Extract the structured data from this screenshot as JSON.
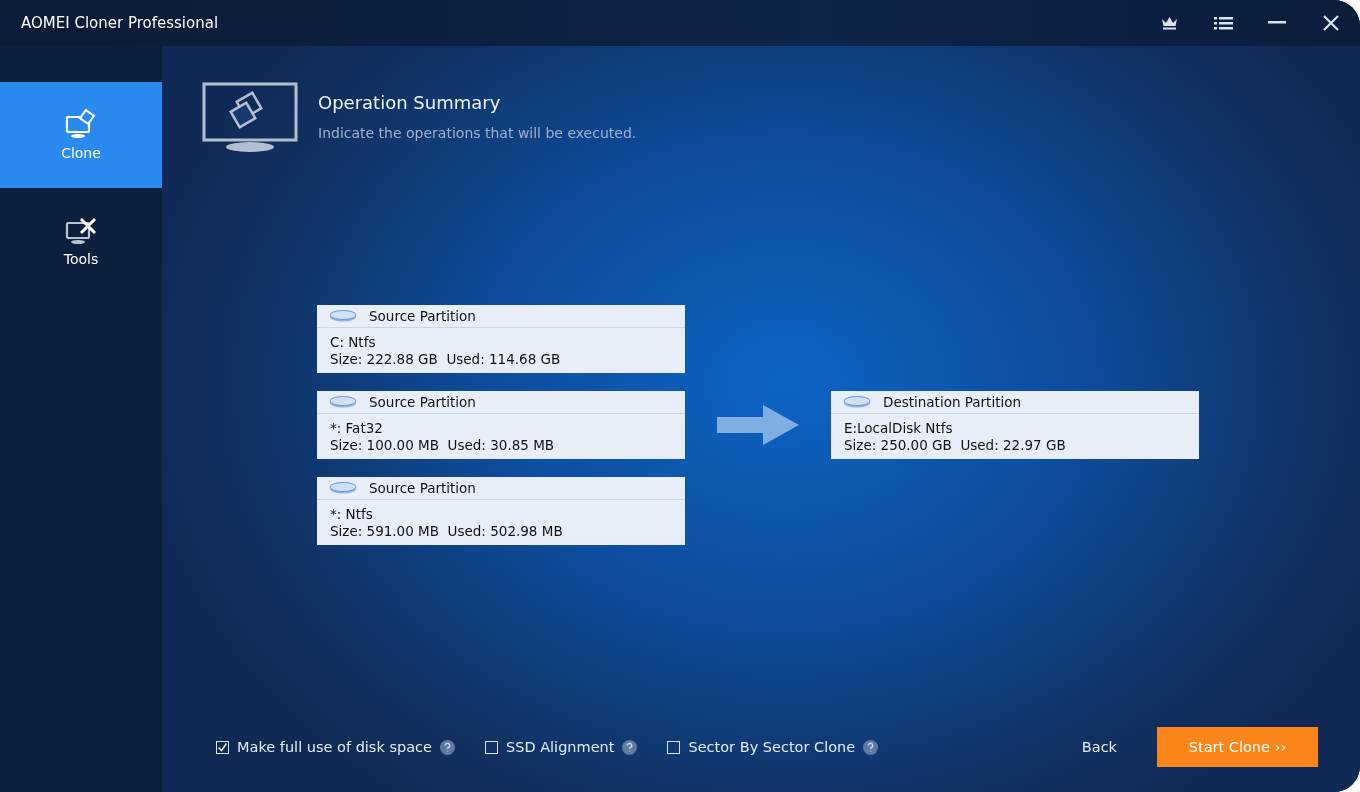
{
  "window": {
    "title": "AOMEI Cloner Professional"
  },
  "sidebar": {
    "items": [
      {
        "label": "Clone",
        "selected": true,
        "kind": "clone"
      },
      {
        "label": "Tools",
        "selected": false,
        "kind": "tools"
      }
    ]
  },
  "header": {
    "title": "Operation Summary",
    "subtitle": "Indicate the operations that will be executed."
  },
  "sources": [
    {
      "heading": "Source Partition",
      "name": "C: Ntfs",
      "details": "Size: 222.88 GB  Used: 114.68 GB"
    },
    {
      "heading": "Source Partition",
      "name": "*: Fat32",
      "details": "Size: 100.00 MB  Used: 30.85 MB"
    },
    {
      "heading": "Source Partition",
      "name": "*: Ntfs",
      "details": "Size: 591.00 MB  Used: 502.98 MB"
    }
  ],
  "destination": {
    "heading": "Destination Partition",
    "name": "E:LocalDisk Ntfs",
    "details": "Size: 250.00 GB  Used: 22.97 GB"
  },
  "options": [
    {
      "label": "Make full use of disk space",
      "checked": true
    },
    {
      "label": "SSD Alignment",
      "checked": false
    },
    {
      "label": "Sector By Sector Clone",
      "checked": false
    }
  ],
  "buttons": {
    "back": "Back",
    "start": "Start Clone ››"
  }
}
